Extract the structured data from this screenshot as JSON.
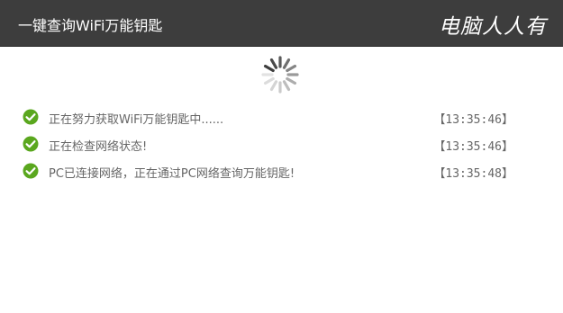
{
  "window": {
    "title": "一键查询WiFi万能钥匙",
    "brand": "电脑人人有"
  },
  "status": {
    "loading_icon": "spinner-icon"
  },
  "log": {
    "items": [
      {
        "icon": "check-circle-icon",
        "message": "正在努力获取WiFi万能钥匙中......",
        "time": "【13:35:46】"
      },
      {
        "icon": "check-circle-icon",
        "message": "正在检查网络状态!",
        "time": "【13:35:46】"
      },
      {
        "icon": "check-circle-icon",
        "message": "PC已连接网络，正在通过PC网络查询万能钥匙!",
        "time": "【13:35:48】"
      }
    ]
  },
  "colors": {
    "titlebar_bg": "#3d3d3d",
    "check_green": "#5aa71e",
    "text_gray": "#666666"
  }
}
